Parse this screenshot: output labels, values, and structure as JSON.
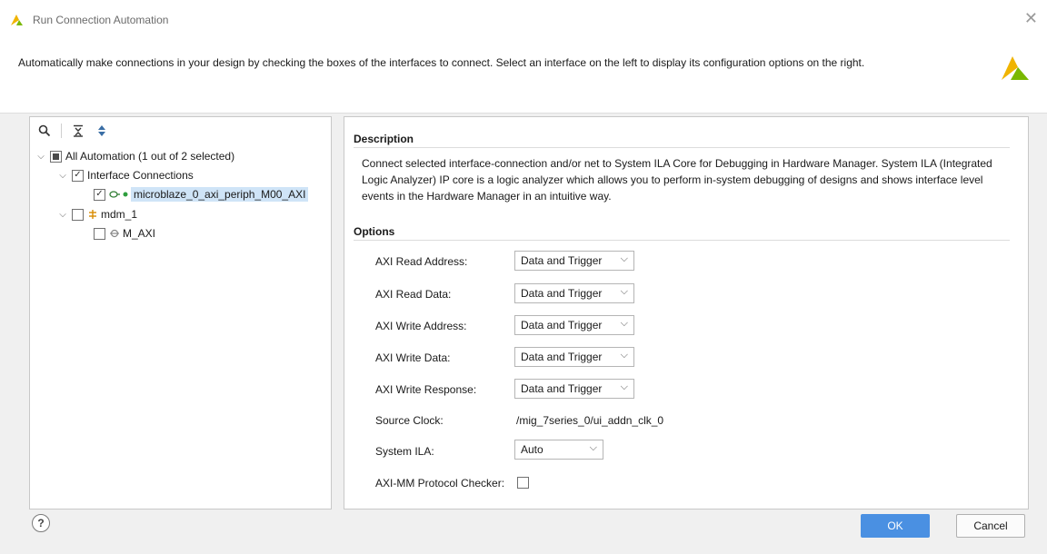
{
  "window": {
    "title": "Run Connection Automation",
    "close_glyph": "✕"
  },
  "banner": {
    "text": "Automatically make connections in your design by checking the boxes of the interfaces to connect. Select an interface on the left to display its configuration options on the right."
  },
  "tree": {
    "root": {
      "label": "All Automation (1 out of 2 selected)",
      "state": "partial"
    },
    "interface_connections": {
      "label": "Interface Connections",
      "state": "checked"
    },
    "microblaze": {
      "label": "microblaze_0_axi_periph_M00_AXI",
      "state": "checked",
      "selected": true
    },
    "mdm": {
      "label": "mdm_1",
      "state": "unchecked"
    },
    "m_axi": {
      "label": "M_AXI",
      "state": "unchecked"
    }
  },
  "description": {
    "title": "Description",
    "text": "Connect selected interface-connection and/or net to System ILA Core for Debugging in Hardware Manager. System ILA (Integrated Logic Analyzer) IP core is a logic analyzer which allows you to perform in-system debugging of designs and shows interface level events in the Hardware Manager in an intuitive way."
  },
  "options": {
    "title": "Options",
    "axi_read_address": {
      "label": "AXI Read Address:",
      "value": "Data and Trigger"
    },
    "axi_read_data": {
      "label": "AXI Read Data:",
      "value": "Data and Trigger"
    },
    "axi_write_address": {
      "label": "AXI Write Address:",
      "value": "Data and Trigger"
    },
    "axi_write_data": {
      "label": "AXI Write Data:",
      "value": "Data and Trigger"
    },
    "axi_write_response": {
      "label": "AXI Write Response:",
      "value": "Data and Trigger"
    },
    "source_clock": {
      "label": "Source Clock:",
      "value": "/mig_7series_0/ui_addn_clk_0"
    },
    "system_ila": {
      "label": "System ILA:",
      "value": "Auto"
    },
    "protocol_checker": {
      "label": "AXI-MM Protocol Checker:",
      "checked": false
    }
  },
  "footer": {
    "help_label": "?",
    "ok_label": "OK",
    "cancel_label": "Cancel"
  },
  "colors": {
    "accent": "#4a90e2",
    "selection": "#cfe4f7",
    "logo_green": "#7ab800",
    "logo_yellow": "#f0b400"
  }
}
